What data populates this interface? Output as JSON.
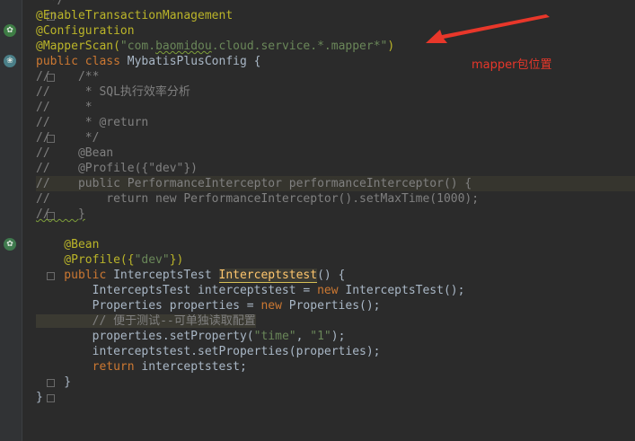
{
  "colors": {
    "background": "#2b2b2b",
    "annotation": "#bbb529",
    "keyword": "#cc7832",
    "string": "#6a8759",
    "comment": "#808080",
    "number": "#6897bb",
    "callout_red": "#e8372a"
  },
  "code": {
    "l0": "  */",
    "l1": "@EnableTransactionManagement",
    "l2": "@Configuration",
    "l3_ann": "@MapperScan(",
    "l3_str_a": "\"com.",
    "l3_str_typo": "baomidou",
    "l3_str_b": ".cloud.service.*.mapper*\"",
    "l3_close": ")",
    "l4_kw": "public class ",
    "l4_name": "MybatisPlusConfig {",
    "l5": "//    /**",
    "l6": "//     * SQL执行效率分析",
    "l7": "//     *",
    "l8": "//     * @return",
    "l9": "//     */",
    "l10": "//    @Bean",
    "l11": "//    @Profile({\"dev\"})",
    "l12": "//    public PerformanceInterceptor performanceInterceptor() {",
    "l13": "//        return new PerformanceInterceptor().setMaxTime(1000);",
    "l14": "//    }",
    "l15": "    @Bean",
    "l16_ann": "    @Profile({",
    "l16_str": "\"dev\"",
    "l16_close": "})",
    "l17_kw": "    public ",
    "l17_type": "InterceptsTest ",
    "l17_name": "Interceptstest",
    "l17_rest": "() {",
    "l18_a": "        InterceptsTest interceptstest = ",
    "l18_kw": "new ",
    "l18_b": "InterceptsTest();",
    "l19_a": "        Properties properties = ",
    "l19_kw": "new ",
    "l19_b": "Properties();",
    "l20": "        // 便于测试--可单独读取配置",
    "l21_a": "        properties.setProperty(",
    "l21_s1": "\"time\"",
    "l21_c": ", ",
    "l21_s2": "\"1\"",
    "l21_end": ");",
    "l22": "        interceptstest.setProperties(properties);",
    "l23_kw": "        return ",
    "l23_b": "interceptstest;",
    "l24": "    }",
    "l25": "}"
  },
  "annotation": {
    "callout_text": "mapper包位置"
  },
  "icons": [
    "spring-bean-icon",
    "spring-config-icon",
    "spring-bean-method-icon",
    "arrow-annotation-icon"
  ]
}
